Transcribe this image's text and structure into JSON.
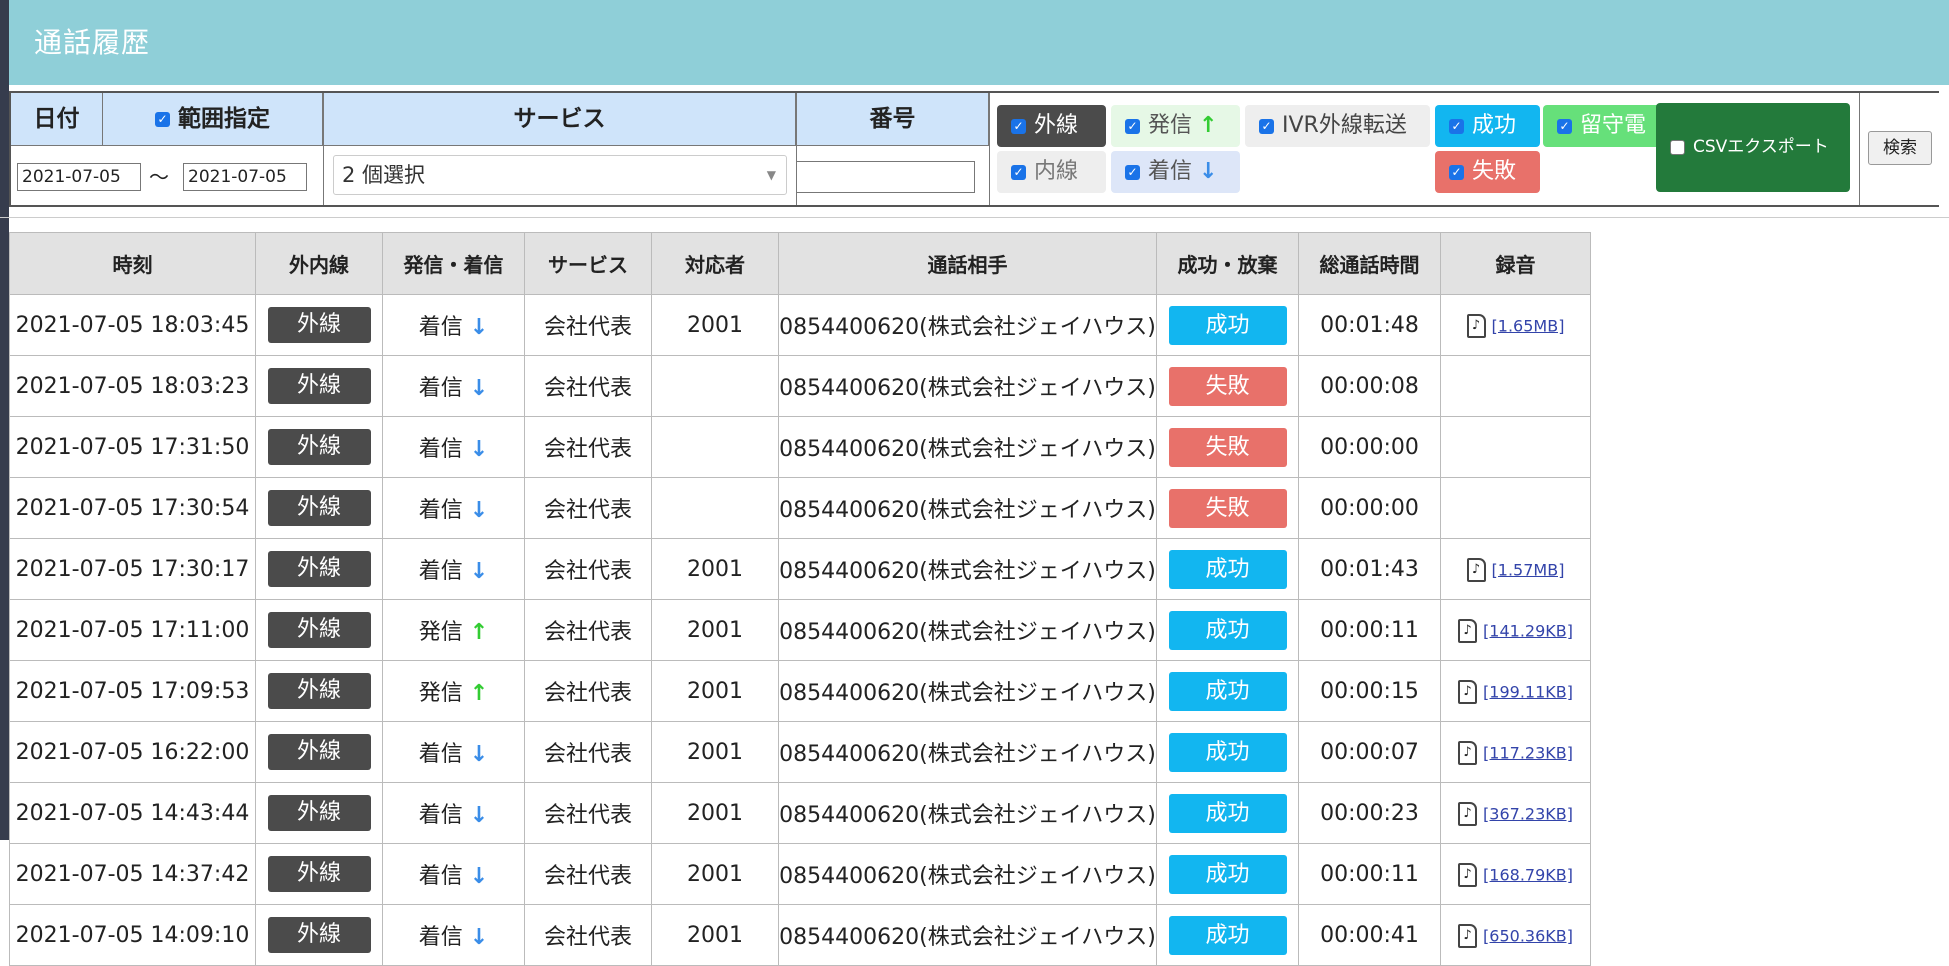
{
  "header": {
    "title": "通話履歴"
  },
  "filter": {
    "date_label": "日付",
    "range_label": "範囲指定",
    "date_from": "2021-07-05",
    "date_sep": "〜",
    "date_to": "2021-07-05",
    "service_label": "サービス",
    "service_selected": "2 個選択",
    "number_label": "番号",
    "number_value": "",
    "chips": {
      "gaisen": "外線",
      "naisen": "内線",
      "hasshin": "発信",
      "chakushin": "着信",
      "ivr": "IVR外線転送",
      "seikou": "成功",
      "shippai": "失敗",
      "rusuden": "留守電"
    },
    "csv_label": "CSVエクスポート",
    "search_label": "検索",
    "colors": {
      "gaisen": "#4b4b4b",
      "hasshin": "#e6f8e6",
      "chakushin": "#dde6f8",
      "ivr": "#eeeeee",
      "seikou": "#12b6f0",
      "shippai": "#e8716a",
      "rusuden": "#66e07a",
      "csv": "#237a3b"
    }
  },
  "table": {
    "headers": [
      "時刻",
      "外内線",
      "発信・着信",
      "サービス",
      "対応者",
      "通話相手",
      "成功・放棄",
      "総通話時間",
      "録音"
    ],
    "rows": [
      {
        "time": "2021-07-05 18:03:45",
        "line": "外線",
        "dir": "着信",
        "dir_icon": "arrow-down-icon",
        "service": "会社代表",
        "agent": "2001",
        "partner": "0854400620(株式会社ジェイハウス)",
        "result": "成功",
        "duration": "00:01:48",
        "rec": "[1.65MB]"
      },
      {
        "time": "2021-07-05 18:03:23",
        "line": "外線",
        "dir": "着信",
        "dir_icon": "arrow-down-icon",
        "service": "会社代表",
        "agent": "",
        "partner": "0854400620(株式会社ジェイハウス)",
        "result": "失敗",
        "duration": "00:00:08",
        "rec": ""
      },
      {
        "time": "2021-07-05 17:31:50",
        "line": "外線",
        "dir": "着信",
        "dir_icon": "arrow-down-icon",
        "service": "会社代表",
        "agent": "",
        "partner": "0854400620(株式会社ジェイハウス)",
        "result": "失敗",
        "duration": "00:00:00",
        "rec": ""
      },
      {
        "time": "2021-07-05 17:30:54",
        "line": "外線",
        "dir": "着信",
        "dir_icon": "arrow-down-icon",
        "service": "会社代表",
        "agent": "",
        "partner": "0854400620(株式会社ジェイハウス)",
        "result": "失敗",
        "duration": "00:00:00",
        "rec": ""
      },
      {
        "time": "2021-07-05 17:30:17",
        "line": "外線",
        "dir": "着信",
        "dir_icon": "arrow-down-icon",
        "service": "会社代表",
        "agent": "2001",
        "partner": "0854400620(株式会社ジェイハウス)",
        "result": "成功",
        "duration": "00:01:43",
        "rec": "[1.57MB]"
      },
      {
        "time": "2021-07-05 17:11:00",
        "line": "外線",
        "dir": "発信",
        "dir_icon": "arrow-up-icon",
        "service": "会社代表",
        "agent": "2001",
        "partner": "0854400620(株式会社ジェイハウス)",
        "result": "成功",
        "duration": "00:00:11",
        "rec": "[141.29KB]"
      },
      {
        "time": "2021-07-05 17:09:53",
        "line": "外線",
        "dir": "発信",
        "dir_icon": "arrow-up-icon",
        "service": "会社代表",
        "agent": "2001",
        "partner": "0854400620(株式会社ジェイハウス)",
        "result": "成功",
        "duration": "00:00:15",
        "rec": "[199.11KB]"
      },
      {
        "time": "2021-07-05 16:22:00",
        "line": "外線",
        "dir": "着信",
        "dir_icon": "arrow-down-icon",
        "service": "会社代表",
        "agent": "2001",
        "partner": "0854400620(株式会社ジェイハウス)",
        "result": "成功",
        "duration": "00:00:07",
        "rec": "[117.23KB]"
      },
      {
        "time": "2021-07-05 14:43:44",
        "line": "外線",
        "dir": "着信",
        "dir_icon": "arrow-down-icon",
        "service": "会社代表",
        "agent": "2001",
        "partner": "0854400620(株式会社ジェイハウス)",
        "result": "成功",
        "duration": "00:00:23",
        "rec": "[367.23KB]"
      },
      {
        "time": "2021-07-05 14:37:42",
        "line": "外線",
        "dir": "着信",
        "dir_icon": "arrow-down-icon",
        "service": "会社代表",
        "agent": "2001",
        "partner": "0854400620(株式会社ジェイハウス)",
        "result": "成功",
        "duration": "00:00:11",
        "rec": "[168.79KB]"
      },
      {
        "time": "2021-07-05 14:09:10",
        "line": "外線",
        "dir": "着信",
        "dir_icon": "arrow-down-icon",
        "service": "会社代表",
        "agent": "2001",
        "partner": "0854400620(株式会社ジェイハウス)",
        "result": "成功",
        "duration": "00:00:41",
        "rec": "[650.36KB]"
      }
    ]
  }
}
